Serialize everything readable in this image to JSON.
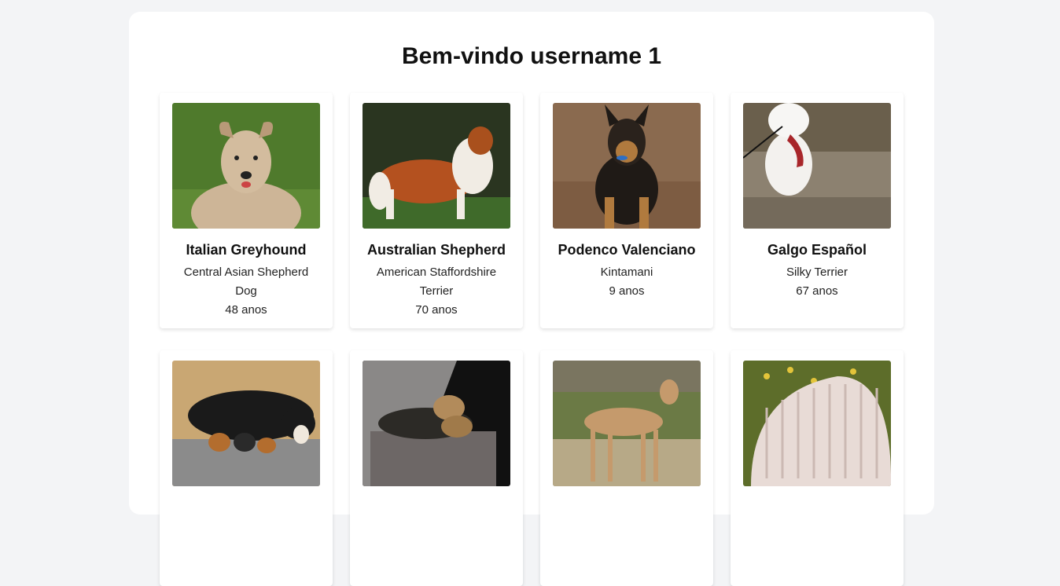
{
  "page": {
    "heading": "Bem-vindo username 1"
  },
  "dogs": [
    {
      "name": "Italian Greyhound",
      "breed": "Central Asian Shepherd Dog",
      "age": "48 anos",
      "photo": "wire-fox-terrier-on-grass"
    },
    {
      "name": "Australian Shepherd",
      "breed": "American Staffordshire Terrier",
      "age": "70 anos",
      "photo": "sheltie-standing-on-grass"
    },
    {
      "name": "Podenco Valenciano",
      "breed": "Kintamani",
      "age": "9 anos",
      "photo": "german-shepherd-puppy-sitting"
    },
    {
      "name": "Galgo Español",
      "breed": "Silky Terrier",
      "age": "67 anos",
      "photo": "white-fluffy-dog-on-bench"
    },
    {
      "name": "",
      "breed": "",
      "age": "",
      "photo": "mother-dog-nursing-puppies"
    },
    {
      "name": "",
      "breed": "",
      "age": "",
      "photo": "small-dogs-on-armchair"
    },
    {
      "name": "",
      "breed": "",
      "age": "",
      "photo": "saluki-standing-in-field"
    },
    {
      "name": "",
      "breed": "",
      "age": "",
      "photo": "komondor-corded-coat"
    }
  ]
}
